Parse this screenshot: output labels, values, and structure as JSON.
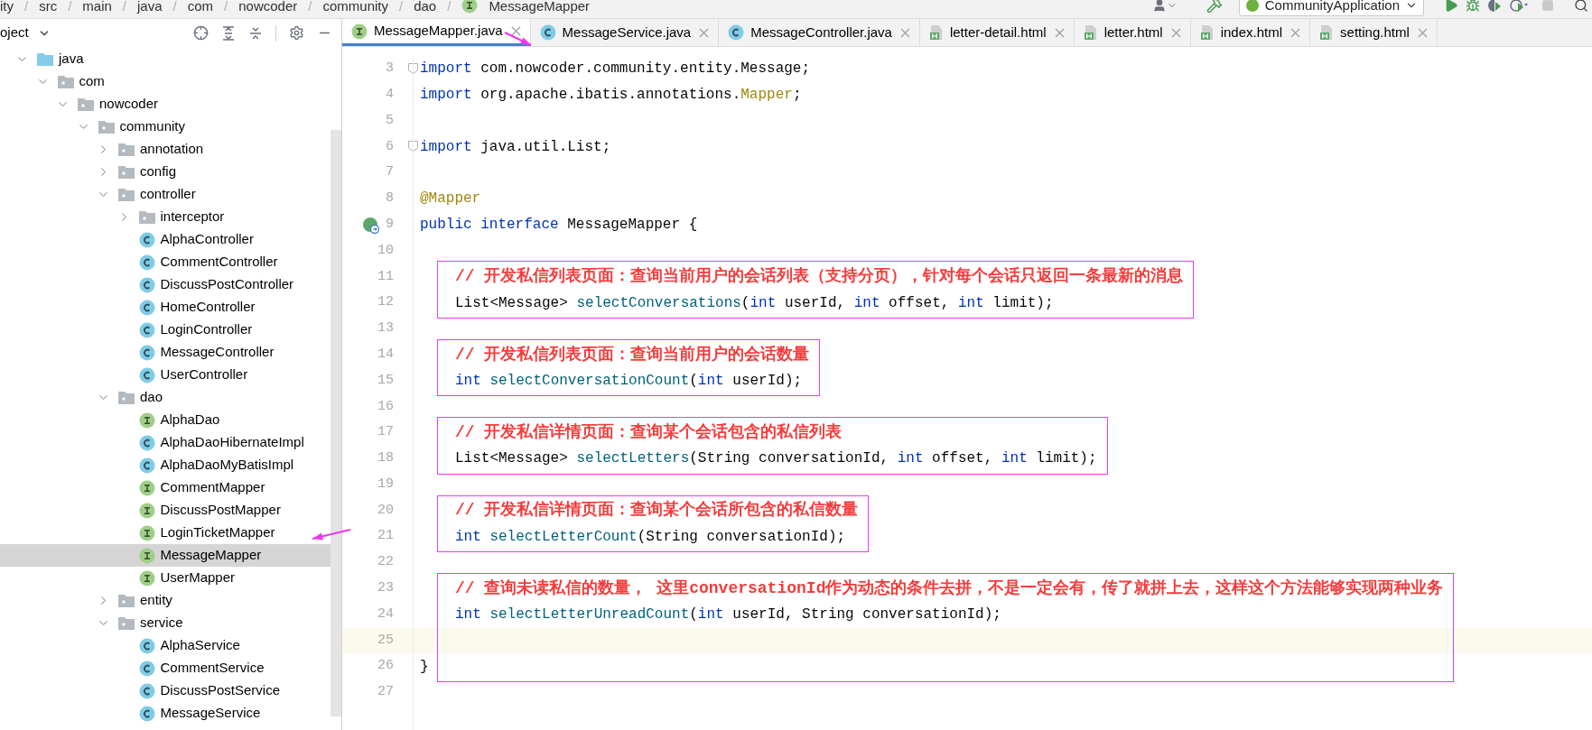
{
  "breadcrumb": [
    {
      "label": "ity"
    },
    {
      "separator": "/",
      "label": "src"
    },
    {
      "separator": "/",
      "label": "main"
    },
    {
      "separator": "/",
      "label": "java"
    },
    {
      "separator": "/",
      "label": "com"
    },
    {
      "separator": "/",
      "label": "nowcoder"
    },
    {
      "separator": "/",
      "label": "community"
    },
    {
      "separator": "/",
      "label": "dao"
    },
    {
      "separator": "/",
      "label": "MessageMapper",
      "kind": "interface"
    }
  ],
  "toolbar": {
    "run_config": "CommunityApplication"
  },
  "sidebar": {
    "title": "oject",
    "tree": [
      {
        "label": "java",
        "kind": "source",
        "expanded": true,
        "selected": false,
        "children": [
          {
            "label": "com",
            "kind": "package",
            "expanded": true,
            "selected": false,
            "children": [
              {
                "label": "nowcoder",
                "kind": "package",
                "expanded": true,
                "selected": false,
                "children": [
                  {
                    "label": "community",
                    "kind": "package",
                    "expanded": true,
                    "selected": false,
                    "children": [
                      {
                        "label": "annotation",
                        "kind": "package",
                        "expanded": false,
                        "selected": false
                      },
                      {
                        "label": "config",
                        "kind": "package",
                        "expanded": false,
                        "selected": false
                      },
                      {
                        "label": "controller",
                        "kind": "package",
                        "expanded": true,
                        "selected": false,
                        "children": [
                          {
                            "label": "interceptor",
                            "kind": "package",
                            "expanded": false,
                            "selected": false
                          },
                          {
                            "label": "AlphaController",
                            "kind": "class",
                            "selected": false
                          },
                          {
                            "label": "CommentController",
                            "kind": "class",
                            "selected": false
                          },
                          {
                            "label": "DiscussPostController",
                            "kind": "class",
                            "selected": false
                          },
                          {
                            "label": "HomeController",
                            "kind": "class",
                            "selected": false
                          },
                          {
                            "label": "LoginController",
                            "kind": "class",
                            "selected": false
                          },
                          {
                            "label": "MessageController",
                            "kind": "class",
                            "selected": false
                          },
                          {
                            "label": "UserController",
                            "kind": "class",
                            "selected": false
                          }
                        ]
                      },
                      {
                        "label": "dao",
                        "kind": "package",
                        "expanded": true,
                        "selected": false,
                        "children": [
                          {
                            "label": "AlphaDao",
                            "kind": "interface",
                            "selected": false
                          },
                          {
                            "label": "AlphaDaoHibernateImpl",
                            "kind": "class",
                            "selected": false
                          },
                          {
                            "label": "AlphaDaoMyBatisImpl",
                            "kind": "class",
                            "selected": false
                          },
                          {
                            "label": "CommentMapper",
                            "kind": "interface",
                            "selected": false
                          },
                          {
                            "label": "DiscussPostMapper",
                            "kind": "interface",
                            "selected": false
                          },
                          {
                            "label": "LoginTicketMapper",
                            "kind": "interface",
                            "selected": false
                          },
                          {
                            "label": "MessageMapper",
                            "kind": "interface",
                            "selected": true
                          },
                          {
                            "label": "UserMapper",
                            "kind": "interface",
                            "selected": false
                          }
                        ]
                      },
                      {
                        "label": "entity",
                        "kind": "package",
                        "expanded": false,
                        "selected": false
                      },
                      {
                        "label": "service",
                        "kind": "package",
                        "expanded": true,
                        "selected": false,
                        "children": [
                          {
                            "label": "AlphaService",
                            "kind": "class",
                            "selected": false
                          },
                          {
                            "label": "CommentService",
                            "kind": "class",
                            "selected": false
                          },
                          {
                            "label": "DiscussPostService",
                            "kind": "class",
                            "selected": false
                          },
                          {
                            "label": "MessageService",
                            "kind": "class",
                            "selected": false
                          }
                        ]
                      }
                    ]
                  }
                ]
              }
            ]
          }
        ]
      }
    ]
  },
  "tabs": [
    {
      "label": "MessageMapper.java",
      "kind": "interface",
      "selected": true
    },
    {
      "label": "MessageService.java",
      "kind": "class",
      "selected": false
    },
    {
      "label": "MessageController.java",
      "kind": "class",
      "selected": false
    },
    {
      "label": "letter-detail.html",
      "kind": "html",
      "selected": false
    },
    {
      "label": "letter.html",
      "kind": "html",
      "selected": false
    },
    {
      "label": "index.html",
      "kind": "html",
      "selected": false
    },
    {
      "label": "setting.html",
      "kind": "html",
      "selected": false
    }
  ],
  "editor": {
    "blocks": [
      {
        "boxed": false,
        "lines": [
          {
            "number": "3",
            "current": false,
            "indented": false,
            "kind": "fold",
            "tokens": [
              {
                "kind": "keyword",
                "text": "import"
              },
              {
                "kind": "plain",
                "text": " com.nowcoder.community.entity.Message;"
              }
            ]
          },
          {
            "number": "4",
            "current": false,
            "indented": false,
            "tokens": [
              {
                "kind": "keyword",
                "text": "import"
              },
              {
                "kind": "plain",
                "text": " org.apache.ibatis.annotations."
              },
              {
                "kind": "annotation",
                "text": "Mapper"
              },
              {
                "kind": "plain",
                "text": ";"
              }
            ]
          },
          {
            "number": "5",
            "current": false,
            "indented": false
          },
          {
            "number": "6",
            "current": false,
            "indented": false,
            "kind": "fold",
            "tokens": [
              {
                "kind": "keyword",
                "text": "import"
              },
              {
                "kind": "plain",
                "text": " java.util.List;"
              }
            ]
          },
          {
            "number": "7",
            "current": false,
            "indented": false
          },
          {
            "number": "8",
            "current": false,
            "indented": false,
            "tokens": [
              {
                "kind": "annotation",
                "text": "@Mapper"
              }
            ]
          },
          {
            "number": "9",
            "current": false,
            "indented": false,
            "kind": "implemented",
            "tokens": [
              {
                "kind": "keyword",
                "text": "public interface"
              },
              {
                "kind": "plain",
                "text": " MessageMapper {"
              }
            ]
          },
          {
            "number": "10",
            "current": false,
            "indented": false
          }
        ]
      },
      {
        "boxed": true,
        "lines": [
          {
            "number": "11",
            "current": false,
            "indented": true,
            "tokens": [
              {
                "kind": "comment",
                "text": "// 开发私信列表页面：查询当前用户的会话列表（支持分页），针对每个会话只返回一条最新的消息"
              }
            ]
          },
          {
            "number": "12",
            "current": false,
            "indented": true,
            "tokens": [
              {
                "kind": "plain",
                "text": "List<Message> "
              },
              {
                "kind": "method",
                "text": "selectConversations"
              },
              {
                "kind": "plain",
                "text": "("
              },
              {
                "kind": "keyword",
                "text": "int"
              },
              {
                "kind": "plain",
                "text": " userId, "
              },
              {
                "kind": "keyword",
                "text": "int"
              },
              {
                "kind": "plain",
                "text": " offset, "
              },
              {
                "kind": "keyword",
                "text": "int"
              },
              {
                "kind": "plain",
                "text": " limit);"
              }
            ]
          }
        ]
      },
      {
        "boxed": false,
        "lines": [
          {
            "number": "13",
            "current": false,
            "indented": false
          }
        ]
      },
      {
        "boxed": true,
        "lines": [
          {
            "number": "14",
            "current": false,
            "indented": true,
            "tokens": [
              {
                "kind": "comment",
                "text": "// 开发私信列表页面：查询当前用户的会话数量"
              }
            ]
          },
          {
            "number": "15",
            "current": false,
            "indented": true,
            "tokens": [
              {
                "kind": "keyword",
                "text": "int"
              },
              {
                "kind": "method",
                "text": " selectConversationCount"
              },
              {
                "kind": "plain",
                "text": "("
              },
              {
                "kind": "keyword",
                "text": "int"
              },
              {
                "kind": "plain",
                "text": " userId);"
              }
            ]
          }
        ]
      },
      {
        "boxed": false,
        "lines": [
          {
            "number": "16",
            "current": false,
            "indented": false
          }
        ]
      },
      {
        "boxed": true,
        "lines": [
          {
            "number": "17",
            "current": false,
            "indented": true,
            "tokens": [
              {
                "kind": "comment",
                "text": "// 开发私信详情页面：查询某个会话包含的私信列表"
              }
            ]
          },
          {
            "number": "18",
            "current": false,
            "indented": true,
            "tokens": [
              {
                "kind": "plain",
                "text": "List<Message> "
              },
              {
                "kind": "method",
                "text": "selectLetters"
              },
              {
                "kind": "plain",
                "text": "(String conversationId, "
              },
              {
                "kind": "keyword",
                "text": "int"
              },
              {
                "kind": "plain",
                "text": " offset, "
              },
              {
                "kind": "keyword",
                "text": "int"
              },
              {
                "kind": "plain",
                "text": " limit);"
              }
            ]
          }
        ]
      },
      {
        "boxed": false,
        "lines": [
          {
            "number": "19",
            "current": false,
            "indented": false
          }
        ]
      },
      {
        "boxed": true,
        "lines": [
          {
            "number": "20",
            "current": false,
            "indented": true,
            "tokens": [
              {
                "kind": "comment",
                "text": "// 开发私信详情页面：查询某个会话所包含的私信数量"
              }
            ]
          },
          {
            "number": "21",
            "current": false,
            "indented": true,
            "tokens": [
              {
                "kind": "keyword",
                "text": "int"
              },
              {
                "kind": "method",
                "text": " selectLetterCount"
              },
              {
                "kind": "plain",
                "text": "(String conversationId);"
              }
            ]
          }
        ]
      },
      {
        "boxed": false,
        "lines": [
          {
            "number": "22",
            "current": false,
            "indented": false
          }
        ]
      },
      {
        "boxed": true,
        "lines": [
          {
            "number": "23",
            "current": false,
            "indented": true,
            "tokens": [
              {
                "kind": "comment",
                "text": "// 查询未读私信的数量， 这里conversationId作为动态的条件去拼，不是一定会有，传了就拼上去，这样这个方法能够实现两种业务"
              }
            ]
          },
          {
            "number": "24",
            "current": false,
            "indented": true,
            "tokens": [
              {
                "kind": "keyword",
                "text": "int"
              },
              {
                "kind": "method",
                "text": " selectLetterUnreadCount"
              },
              {
                "kind": "plain",
                "text": "("
              },
              {
                "kind": "keyword",
                "text": "int"
              },
              {
                "kind": "plain",
                "text": " userId, String conversationId);"
              }
            ]
          },
          {
            "number": "25",
            "current": true,
            "indented": false
          },
          {
            "number": "26",
            "current": false,
            "indented": false,
            "tokens": [
              {
                "kind": "plain",
                "text": "}"
              }
            ]
          }
        ]
      },
      {
        "boxed": false,
        "lines": [
          {
            "number": "27",
            "current": false,
            "indented": false
          }
        ]
      }
    ]
  }
}
